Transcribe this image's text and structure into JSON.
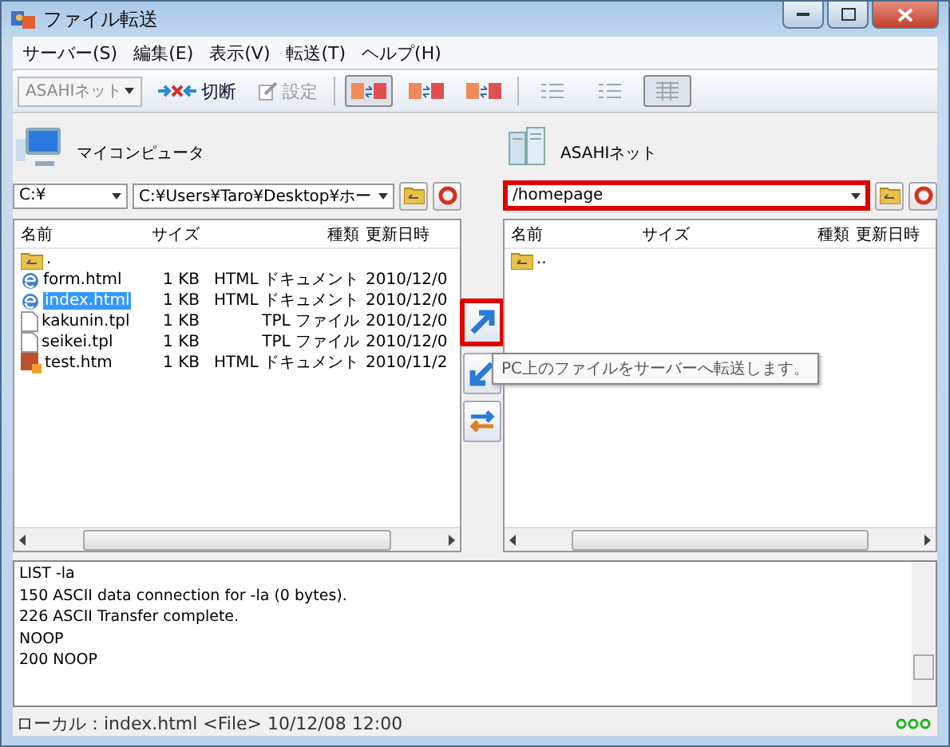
{
  "window": {
    "title": "ファイル転送"
  },
  "menu": [
    {
      "label": "サーバー(S)"
    },
    {
      "label": "編集(E)"
    },
    {
      "label": "表示(V)"
    },
    {
      "label": "転送(T)"
    },
    {
      "label": "ヘルプ(H)"
    }
  ],
  "toolbar": {
    "host": "ASAHIネット",
    "disconnect": "切断",
    "settings": {
      "label": "設定",
      "disabled": true
    },
    "views": [
      {
        "kind": "panes",
        "selected": true
      },
      {
        "kind": "panes",
        "selected": false
      },
      {
        "kind": "panes",
        "selected": false
      },
      {
        "kind": "list",
        "selected": false
      },
      {
        "kind": "list",
        "selected": false
      },
      {
        "kind": "details",
        "selected": true
      }
    ]
  },
  "local": {
    "title": "マイコンピュータ",
    "drive": "C:¥",
    "path": "C:¥Users¥Taro¥Desktop¥ホー",
    "highlighted": false,
    "columns": [
      "名前",
      "サイズ",
      "種類",
      "更新日時"
    ],
    "files": [
      {
        "kind": "parent",
        "name": ".",
        "selected": false
      },
      {
        "kind": "web",
        "name": "form.html",
        "size": "1 KB",
        "type": "HTML ドキュメント",
        "date": "2010/12/0",
        "selected": false
      },
      {
        "kind": "web",
        "name": "index.html",
        "size": "1 KB",
        "type": "HTML ドキュメント",
        "date": "2010/12/0",
        "selected": true
      },
      {
        "kind": "doc",
        "name": "kakunin.tpl",
        "size": "1 KB",
        "type": "TPL ファイル",
        "date": "2010/12/0",
        "selected": false
      },
      {
        "kind": "doc",
        "name": "seikei.tpl",
        "size": "1 KB",
        "type": "TPL ファイル",
        "date": "2010/12/0",
        "selected": false
      },
      {
        "kind": "image",
        "name": "test.htm",
        "size": "1 KB",
        "type": "HTML ドキュメント",
        "date": "2010/11/2",
        "selected": false
      }
    ]
  },
  "remote": {
    "title": "ASAHIネット",
    "path": "/homepage",
    "highlighted": true,
    "columns": [
      "名前",
      "サイズ",
      "種類",
      "更新日時"
    ],
    "files": [
      {
        "kind": "parent",
        "name": "..",
        "selected": false
      }
    ]
  },
  "transfer_buttons": [
    {
      "kind": "upload",
      "highlighted": true
    },
    {
      "kind": "download",
      "highlighted": false
    },
    {
      "kind": "sync",
      "highlighted": false
    }
  ],
  "tooltip": {
    "text": "PC上のファイルをサーバーへ転送します。"
  },
  "log": [
    "LIST -la",
    "150  ASCII data connection for -la (0 bytes).",
    "226  ASCII Transfer complete.",
    "NOOP",
    "200  NOOP"
  ],
  "status_bar": {
    "text": "ローカル：index.html <File> 10/12/08 12:00"
  }
}
